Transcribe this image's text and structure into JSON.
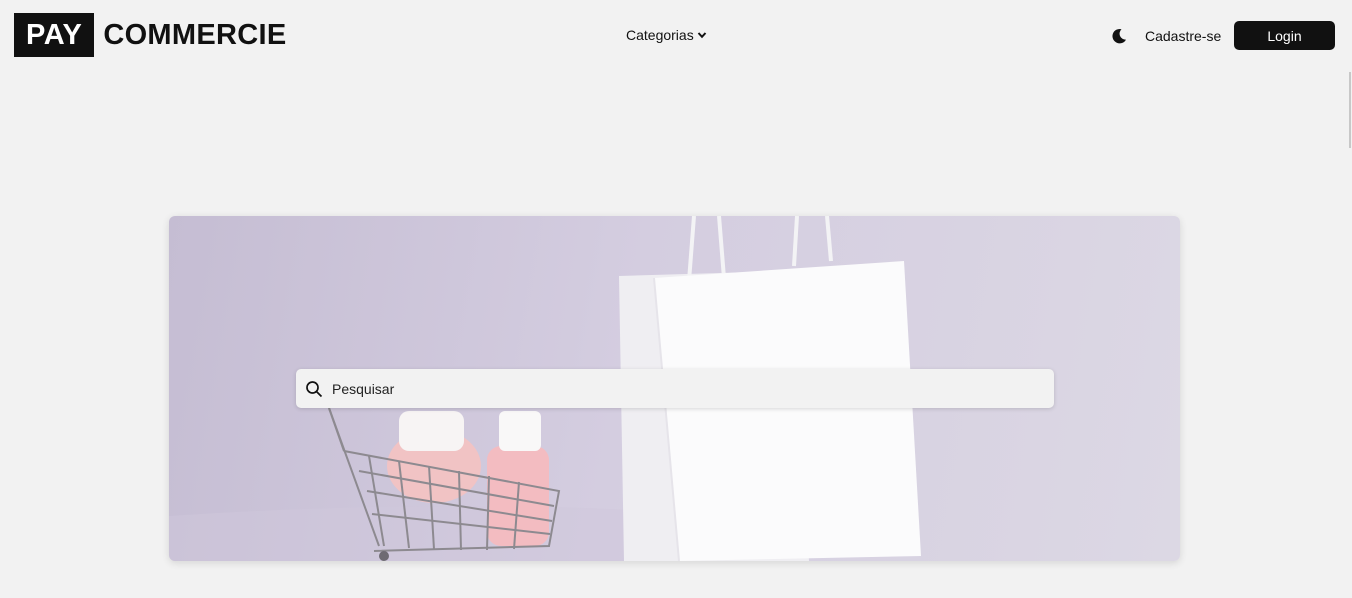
{
  "brand": {
    "box_text": "PAY",
    "text": "COMMERCIE"
  },
  "nav": {
    "categories_label": "Categorias"
  },
  "header": {
    "signup_label": "Cadastre-se",
    "login_label": "Login"
  },
  "hero": {
    "search_placeholder": "Pesquisar"
  },
  "icons": {
    "theme_toggle": "moon-icon",
    "categories_dropdown": "chevron-down-icon",
    "search": "search-icon"
  },
  "colors": {
    "background": "#f2f2f2",
    "primary": "#111111",
    "hero_bg": "#d2cbde"
  }
}
